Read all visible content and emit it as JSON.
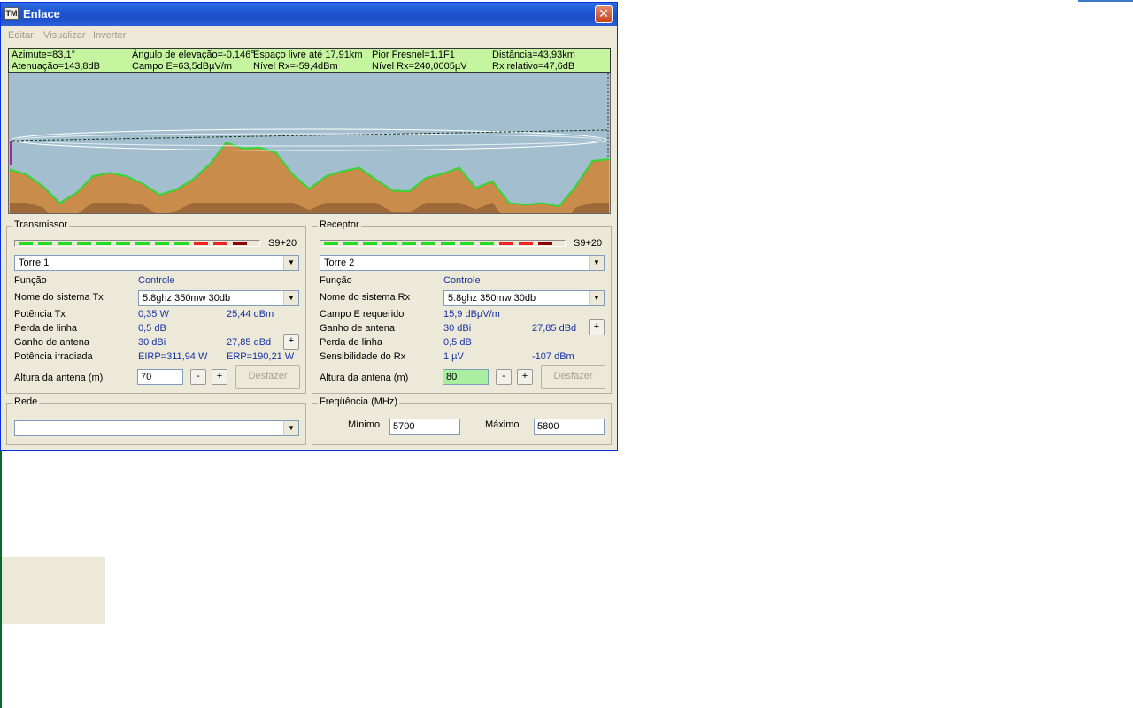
{
  "window": {
    "title": "Enlace",
    "close_glyph": "✕",
    "icon_glyph": "TM"
  },
  "menu": [
    "Editar",
    "Visualizar",
    "Inverter"
  ],
  "status": {
    "azimute": "Azimute=83,1°",
    "angulo": "Ângulo de elevação=-0,146°",
    "espaco": "Espaço livre até 17,91km",
    "fresnel": "Pior Fresnel=1,1F1",
    "distancia": "Distância=43,93km",
    "atenuacao": "Atenuação=143,8dB",
    "campo": "Campo E=63,5dBµV/m",
    "nivel_dbm": "Nível Rx=-59,4dBm",
    "nivel_uv": "Nível Rx=240,0005µV",
    "rx_relativo": "Rx relativo=47,6dB"
  },
  "profile": {
    "elevation": [
      50,
      44,
      30,
      10,
      22,
      42,
      46,
      42,
      33,
      20,
      26,
      38,
      56,
      82,
      75,
      76,
      70,
      44,
      27,
      42,
      48,
      52,
      38,
      25,
      24,
      40,
      45,
      52,
      28,
      36,
      10,
      8,
      10,
      6,
      30,
      60,
      62
    ]
  },
  "transmissor": {
    "group_title": "Transmissor",
    "meter_label": "S9+20",
    "tower": "Torre 1",
    "funcao_label": "Função",
    "funcao_value": "Controle",
    "sistema_label": "Nome do sistema Tx",
    "sistema_value": "5.8ghz 350mw 30db",
    "potencia_label": "Potência Tx",
    "potencia_w": "0,35 W",
    "potencia_dbm": "25,44 dBm",
    "perda_label": "Perda de linha",
    "perda_value": "0,5 dB",
    "ganho_label": "Ganho de antena",
    "ganho_dbi": "30 dBi",
    "ganho_dbd": "27,85 dBd",
    "irradiada_label": "Potência irradiada",
    "eirp": "EIRP=311,94 W",
    "erp": "ERP=190,21 W",
    "altura_label": "Altura da antena (m)",
    "altura_value": "70",
    "desfazer": "Desfazer",
    "minus": "-",
    "plus": "+"
  },
  "receptor": {
    "group_title": "Receptor",
    "meter_label": "S9+20",
    "tower": "Torre 2",
    "funcao_label": "Função",
    "funcao_value": "Controle",
    "sistema_label": "Nome do sistema Rx",
    "sistema_value": "5.8ghz 350mw 30db",
    "campo_label": "Campo E requerido",
    "campo_value": "15,9 dBµV/m",
    "ganho_label": "Ganho de antena",
    "ganho_dbi": "30 dBi",
    "ganho_dbd": "27,85 dBd",
    "perda_label": "Perda de linha",
    "perda_value": "0,5 dB",
    "sens_label": "Sensibilidade do Rx",
    "sens_uv": "1 µV",
    "sens_dbm": "-107 dBm",
    "altura_label": "Altura da antena (m)",
    "altura_value": "80",
    "desfazer": "Desfazer",
    "minus": "-",
    "plus": "+"
  },
  "rede": {
    "group_title": "Rede",
    "value": ""
  },
  "frequencia": {
    "group_title": "Freqüência (MHz)",
    "min_label": "Mínimo",
    "min_value": "5700",
    "max_label": "Máximo",
    "max_value": "5800"
  },
  "colors": {
    "terrain": "#c98c4a",
    "terrain_dark": "#8a5a30",
    "terrain_edge": "#33d633",
    "sky": "#a3bfcf",
    "status_bg": "#c6f5a0",
    "value_text": "#1733a6"
  }
}
